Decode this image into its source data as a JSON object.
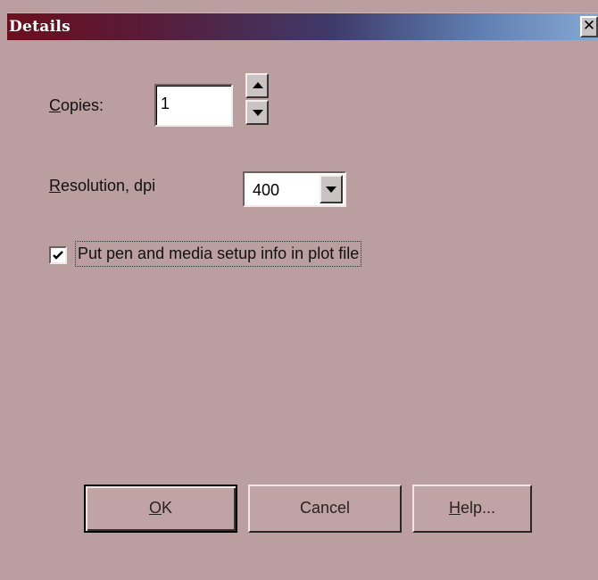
{
  "window": {
    "title": "Details",
    "close_glyph": "✕"
  },
  "copies": {
    "label_accel": "C",
    "label_rest": "opies:",
    "value": "1"
  },
  "resolution": {
    "label_accel": "R",
    "label_rest": "esolution, dpi",
    "selected": "400"
  },
  "setup_info": {
    "label": "Put pen and media setup info in plot file",
    "checked": true
  },
  "buttons": {
    "ok_accel": "O",
    "ok_rest": "K",
    "cancel": "Cancel",
    "help_accel": "H",
    "help_rest": "elp..."
  },
  "icons": {
    "close": "close-icon",
    "spin_up": "arrow-up-icon",
    "spin_down": "arrow-down-icon",
    "dropdown": "chevron-down-icon",
    "check": "checkmark-icon"
  },
  "colors": {
    "dialog_bg": "#bb9ea0",
    "title_start": "#6b0f1e",
    "title_end": "#86a8d3"
  }
}
